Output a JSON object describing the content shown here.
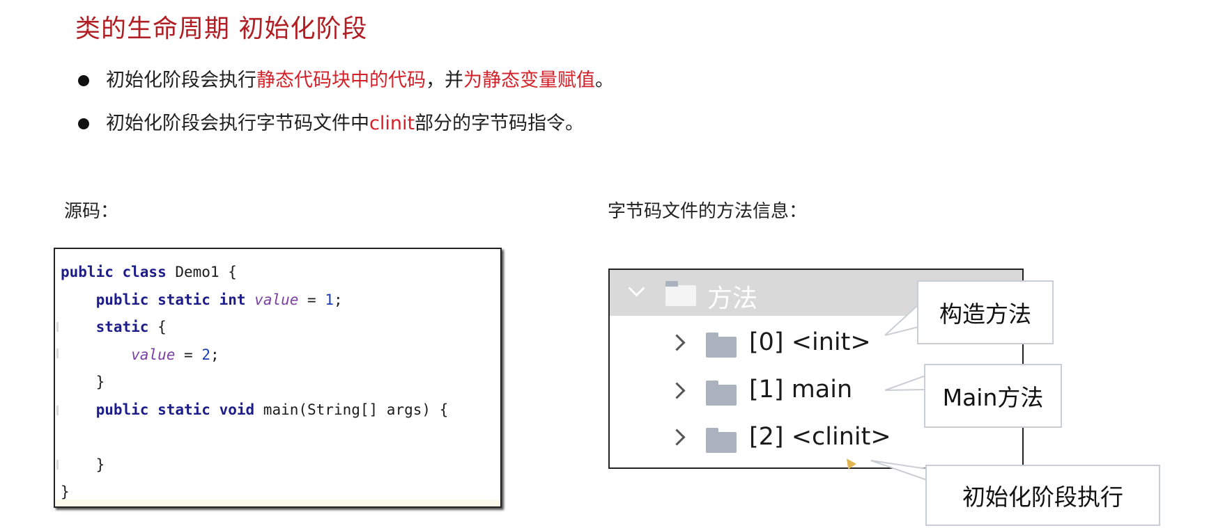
{
  "title": "类的生命周期 初始化阶段",
  "bullets": [
    {
      "p1": "初始化阶段会执行",
      "r1": "静态代码块中的代码",
      "p2": "，并",
      "r2": "为静态变量赋值",
      "p3": "。"
    },
    {
      "p1": "初始化阶段会执行字节码文件中",
      "r1": "clinit",
      "p2": "部分的字节码指令。"
    }
  ],
  "source_label": "源码：",
  "methods_label": "字节码文件的方法信息：",
  "code": {
    "l1_kw": "public class",
    "l1_rest": " Demo1 {",
    "l2_kw1": "public static int",
    "l2_var": "value",
    "l2_eq": " = ",
    "l2_num": "1",
    "l2_end": ";",
    "l3_kw": "static",
    "l3_rest": " {",
    "l4_var": "value",
    "l4_eq": " = ",
    "l4_num": "2",
    "l4_end": ";",
    "l5": "}",
    "l6_kw": "public static void",
    "l6_rest": " main(String[] args) {",
    "l8": "}",
    "l9": "}"
  },
  "tree": {
    "header": "方法",
    "items": [
      "[0] <init>",
      "[1] main",
      "[2] <clinit>"
    ]
  },
  "callouts": {
    "init": "构造方法",
    "main": "Main方法",
    "clinit": "初始化阶段执行"
  },
  "icons": [
    "chevron-down-icon",
    "folder-icon",
    "chevron-right-icon",
    "cursor-icon"
  ]
}
